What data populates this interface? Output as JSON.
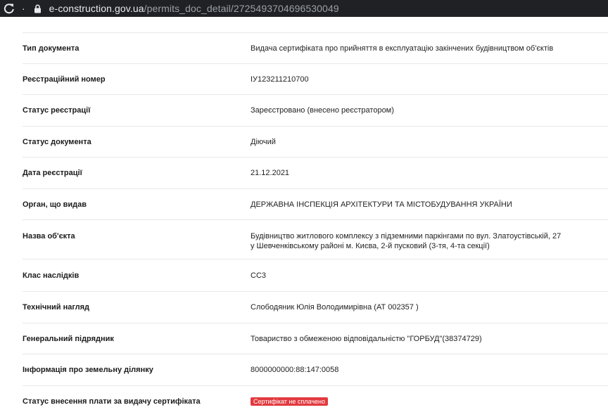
{
  "browser": {
    "url_host": "e-construction.gov.ua",
    "url_path": "/permits_doc_detail/2725493704696530049"
  },
  "rows": [
    {
      "label": "Тип документа",
      "value": "Видача сертифіката про прийняття в експлуатацію закінчених будівництвом об'єктів"
    },
    {
      "label": "Реєстраційний номер",
      "value": "ІУ123211210700"
    },
    {
      "label": "Статус реєстрації",
      "value": "Зареєстровано (внесено реєстратором)"
    },
    {
      "label": "Статус документа",
      "value": "Діючий"
    },
    {
      "label": "Дата реєстрації",
      "value": "21.12.2021"
    },
    {
      "label": "Орган, що видав",
      "value": "ДЕРЖАВНА ІНСПЕКЦІЯ АРХІТЕКТУРИ ТА МІСТОБУДУВАННЯ УКРАЇНИ"
    },
    {
      "label": "Назва об'єкта",
      "value_line1": "Будівництво житлового комплексу з підземними паркінгами по вул. Златоустівській, 27",
      "value_line2": "у Шевченківському районі м. Києва, 2-й пусковий (3-тя, 4-та секції)"
    },
    {
      "label": "Клас наслідків",
      "value": "СС3"
    },
    {
      "label": "Технічний нагляд",
      "value": "Слободяник Юлія Володимирівна (АТ 002357 )"
    },
    {
      "label": "Генеральний підрядник",
      "value": "Товариство з обмеженою відповідальністю \"ГОРБУД\"(38374729)"
    },
    {
      "label": "Інформація про земельну ділянку",
      "value": "8000000000:88:147:0058"
    },
    {
      "label": "Статус внесення плати за видачу сертифіката",
      "badge": "Сертифікат не сплачено"
    }
  ],
  "colors": {
    "badge": "#e23a3f",
    "browser_bar": "#202124"
  }
}
